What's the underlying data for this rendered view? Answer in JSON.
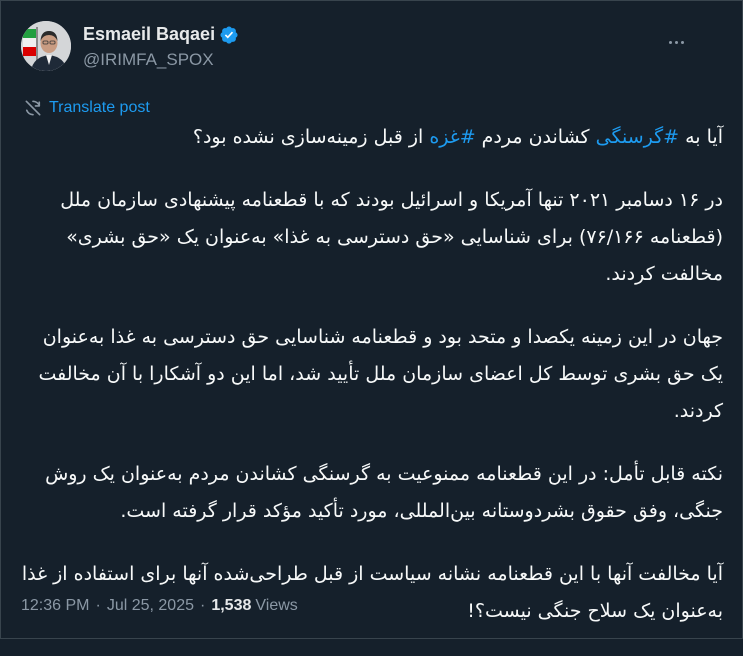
{
  "author": {
    "display_name": "Esmaeil Baqaei",
    "handle": "@IRIMFA_SPOX",
    "verified": true,
    "avatar_icon": "profile-photo-with-flag"
  },
  "translate_label": "Translate post",
  "tweet": {
    "p1": {
      "pre": "آیا به ",
      "tag1": "#گرسنگی",
      "mid": " کشاندن مردم ",
      "tag2": "#غزه",
      "post": " از قبل زمینه‌سازی نشده بود؟"
    },
    "p2": "در ۱۶ دسامبر ۲۰۲۱ تنها آمریکا و اسرائیل بودند که با قطعنامه پیشنهادی سازمان ملل (قطعنامه ۷۶/۱۶۶) برای شناسایی «حق دسترسی به غذا» به‌عنوان یک «حق بشری» مخالفت کردند.",
    "p3": "جهان در این زمینه یکصدا و متحد بود و قطعنامه شناسایی حق دسترسی به غذا به‌عنوان یک حق بشری توسط کل اعضای سازمان ملل تأیید شد، اما این دو آشکارا با آن مخالفت کردند.",
    "p4": "نکته قابل تأمل: در این قطعنامه ممنوعیت به گرسنگی کشاندن مردم به‌عنوان یک روش جنگی، وفق حقوق بشردوستانه بین‌المللی، مورد تأکید مؤکد قرار گرفته است.",
    "p5": "آیا مخالفت آنها با این قطعنامه نشانه سیاست از قبل طراحی‌شده آنها برای استفاده از غذا به‌عنوان یک سلاح جنگی نیست؟!"
  },
  "meta": {
    "time": "12:36 PM",
    "separator": "·",
    "date": "Jul 25, 2025",
    "views_count": "1,538",
    "views_label": "Views"
  },
  "colors": {
    "background": "#15202b",
    "accent": "#1d9bf0",
    "muted": "#8b98a5",
    "text": "#f7f9f9"
  }
}
